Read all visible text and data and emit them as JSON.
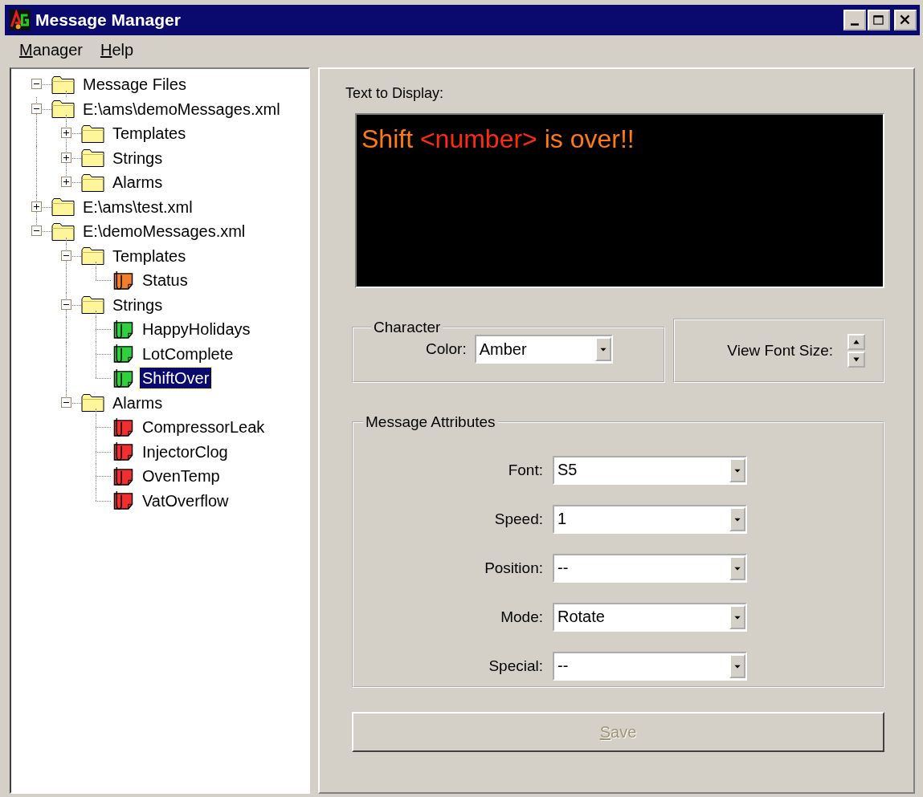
{
  "window": {
    "title": "Message Manager"
  },
  "menu": [
    {
      "label": "Manager"
    },
    {
      "label": "Help"
    }
  ],
  "tree": [
    {
      "label": "Message Files",
      "kind": "folder",
      "expanded": true,
      "selected": false,
      "children": [
        {
          "label": "E:\\ams\\demoMessages.xml",
          "kind": "folder",
          "expanded": true,
          "selected": false,
          "children": [
            {
              "label": "Templates",
              "kind": "folder",
              "expanded": false,
              "selected": false
            },
            {
              "label": "Strings",
              "kind": "folder",
              "expanded": false,
              "selected": false
            },
            {
              "label": "Alarms",
              "kind": "folder",
              "expanded": false,
              "selected": false
            }
          ]
        },
        {
          "label": "E:\\ams\\test.xml",
          "kind": "folder",
          "expanded": false,
          "selected": false
        },
        {
          "label": "E:\\demoMessages.xml",
          "kind": "folder",
          "expanded": true,
          "selected": false,
          "children": [
            {
              "label": "Templates",
              "kind": "folder",
              "expanded": true,
              "selected": false,
              "children": [
                {
                  "label": "Status",
                  "kind": "message",
                  "color": "#f08030",
                  "selected": false
                }
              ]
            },
            {
              "label": "Strings",
              "kind": "folder",
              "expanded": true,
              "selected": false,
              "children": [
                {
                  "label": "HappyHolidays",
                  "kind": "message",
                  "color": "#30d040",
                  "selected": false
                },
                {
                  "label": "LotComplete",
                  "kind": "message",
                  "color": "#30d040",
                  "selected": false
                },
                {
                  "label": "ShiftOver",
                  "kind": "message",
                  "color": "#30d040",
                  "selected": true
                }
              ]
            },
            {
              "label": "Alarms",
              "kind": "folder",
              "expanded": true,
              "selected": false,
              "children": [
                {
                  "label": "CompressorLeak",
                  "kind": "message",
                  "color": "#f03030",
                  "selected": false
                },
                {
                  "label": "InjectorClog",
                  "kind": "message",
                  "color": "#f03030",
                  "selected": false
                },
                {
                  "label": "OvenTemp",
                  "kind": "message",
                  "color": "#f03030",
                  "selected": false
                },
                {
                  "label": "VatOverflow",
                  "kind": "message",
                  "color": "#f03030",
                  "selected": false
                }
              ]
            }
          ]
        }
      ]
    }
  ],
  "display": {
    "label": "Text to Display:",
    "segments": [
      {
        "text": "Shift ",
        "color": "#ff7a10"
      },
      {
        "text": "<number>",
        "color": "#ff2a10"
      },
      {
        "text": " is over!!",
        "color": "#ff7a10"
      }
    ]
  },
  "character": {
    "legend": "Character",
    "color_label": "Color:",
    "color_value": "Amber"
  },
  "font_size": {
    "label": "View Font Size:"
  },
  "attributes": {
    "legend": "Message Attributes",
    "fields": [
      {
        "label": "Font:",
        "value": "S5"
      },
      {
        "label": "Speed:",
        "value": "1"
      },
      {
        "label": "Position:",
        "value": "--"
      },
      {
        "label": "Mode:",
        "value": "Rotate"
      },
      {
        "label": "Special:",
        "value": "--"
      }
    ]
  },
  "save": {
    "label": "Save",
    "disabled": true
  }
}
